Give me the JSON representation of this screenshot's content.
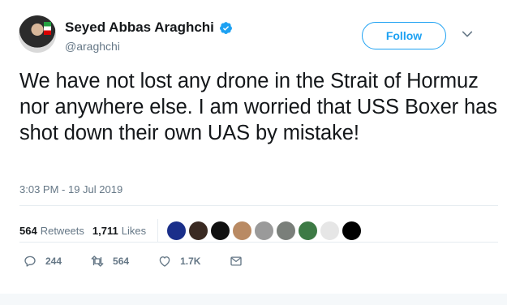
{
  "author": {
    "name": "Seyed Abbas Araghchi",
    "handle": "@araghchi",
    "verified": true
  },
  "follow_button": {
    "label": "Follow"
  },
  "tweet": {
    "text": "We have not lost any drone in the Strait of Hormuz nor anywhere else. I am worried that USS Boxer has shot down their own UAS by mistake!",
    "timestamp": "3:03 PM - 19 Jul 2019"
  },
  "stats": {
    "retweets_count": "564",
    "retweets_label": "Retweets",
    "likes_count": "1,711",
    "likes_label": "Likes"
  },
  "likers": [
    {
      "name": "liker-avatar-1",
      "color": "#1a2f8a"
    },
    {
      "name": "liker-avatar-2",
      "color": "#3a2a22"
    },
    {
      "name": "liker-avatar-3",
      "color": "#111111"
    },
    {
      "name": "liker-avatar-4",
      "color": "#b98a63"
    },
    {
      "name": "liker-avatar-5",
      "color": "#9a9a9a"
    },
    {
      "name": "liker-avatar-6",
      "color": "#7a7f7a"
    },
    {
      "name": "liker-avatar-7",
      "color": "#3d7a45"
    },
    {
      "name": "liker-avatar-8",
      "color": "#e6e6e6"
    },
    {
      "name": "liker-avatar-9",
      "color": "#000000"
    }
  ],
  "actions": {
    "reply_count": "244",
    "retweet_count": "564",
    "like_count": "1.7K"
  },
  "colors": {
    "accent": "#1da1f2",
    "secondary_text": "#657786",
    "primary_text": "#14171a",
    "divider": "#e6ecf0"
  },
  "icons": [
    "verified-badge-icon",
    "chevron-down-icon",
    "reply-icon",
    "retweet-icon",
    "like-heart-icon",
    "direct-message-icon"
  ]
}
